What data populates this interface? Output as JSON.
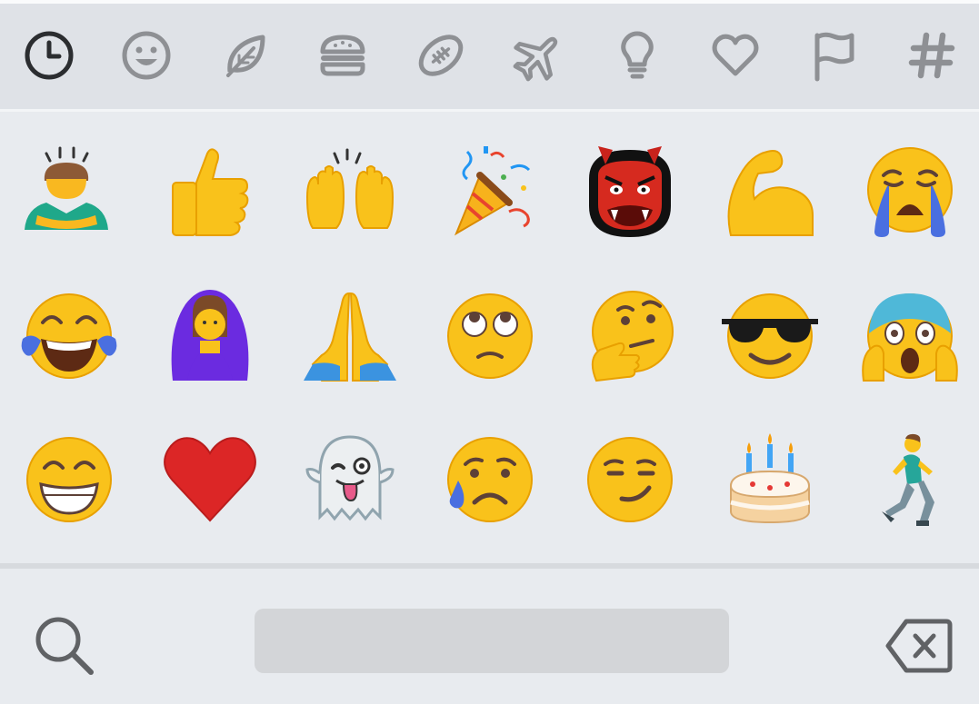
{
  "colors": {
    "category_bar_bg": "#dfe2e7",
    "grid_bg": "#e8ebef",
    "icon_gray": "#8e9094",
    "icon_active": "#2b2d30",
    "space_bar": "#d3d5d8"
  },
  "category_bar": {
    "items": [
      {
        "icon": "clock-icon",
        "active": true
      },
      {
        "icon": "smiley-icon",
        "active": false
      },
      {
        "icon": "leaf-icon",
        "active": false
      },
      {
        "icon": "burger-icon",
        "active": false
      },
      {
        "icon": "football-icon",
        "active": false
      },
      {
        "icon": "airplane-icon",
        "active": false
      },
      {
        "icon": "lightbulb-icon",
        "active": false
      },
      {
        "icon": "heart-outline-icon",
        "active": false
      },
      {
        "icon": "flag-icon",
        "active": false
      },
      {
        "icon": "hashtag-icon",
        "active": false
      }
    ]
  },
  "emoji_grid": {
    "rows": [
      [
        {
          "name": "person-bowing"
        },
        {
          "name": "thumbs-up"
        },
        {
          "name": "raising-hands"
        },
        {
          "name": "party-popper"
        },
        {
          "name": "ogre"
        },
        {
          "name": "flexed-biceps"
        },
        {
          "name": "loudly-crying-face"
        }
      ],
      [
        {
          "name": "face-with-tears-of-joy"
        },
        {
          "name": "woman-gesturing-ok"
        },
        {
          "name": "folded-hands"
        },
        {
          "name": "face-with-rolling-eyes"
        },
        {
          "name": "thinking-face"
        },
        {
          "name": "smiling-face-with-sunglasses"
        },
        {
          "name": "face-screaming-in-fear"
        }
      ],
      [
        {
          "name": "beaming-face-with-smiling-eyes"
        },
        {
          "name": "red-heart"
        },
        {
          "name": "ghost"
        },
        {
          "name": "sad-but-relieved-face"
        },
        {
          "name": "smirking-face"
        },
        {
          "name": "birthday-cake"
        },
        {
          "name": "person-running"
        }
      ]
    ]
  },
  "bottom_bar": {
    "search_icon": "search-icon",
    "backspace_icon": "backspace-icon",
    "space_bar_label": ""
  }
}
